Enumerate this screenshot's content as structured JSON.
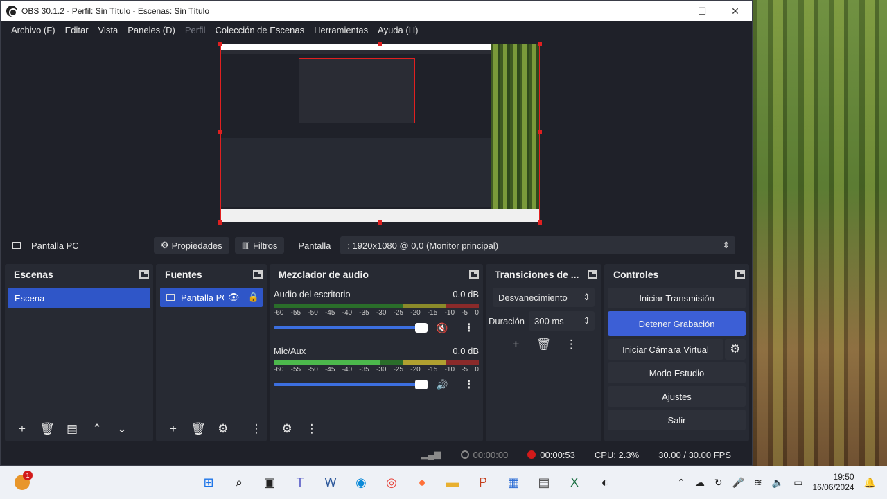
{
  "window": {
    "title": "OBS 30.1.2 - Perfil: Sin Título - Escenas: Sin Título",
    "minimize": "—",
    "maximize": "☐",
    "close": "✕"
  },
  "menu": [
    {
      "label": "Archivo (F)",
      "disabled": false
    },
    {
      "label": "Editar",
      "disabled": false
    },
    {
      "label": "Vista",
      "disabled": false
    },
    {
      "label": "Paneles (D)",
      "disabled": false
    },
    {
      "label": "Perfil",
      "disabled": true
    },
    {
      "label": "Colección de Escenas",
      "disabled": false
    },
    {
      "label": "Herramientas",
      "disabled": false
    },
    {
      "label": "Ayuda (H)",
      "disabled": false
    }
  ],
  "source_toolbar": {
    "source_name": "Pantalla PC",
    "properties": "Propiedades",
    "filters": "Filtros",
    "display_label": "Pantalla",
    "display_value": ": 1920x1080 @ 0,0 (Monitor principal)"
  },
  "docks": {
    "scenes": {
      "title": "Escenas",
      "items": [
        "Escena"
      ]
    },
    "sources": {
      "title": "Fuentes",
      "items": [
        "Pantalla PC"
      ]
    },
    "mixer": {
      "title": "Mezclador de audio",
      "channels": [
        {
          "name": "Audio del escritorio",
          "db": "0.0 dB",
          "muted": true
        },
        {
          "name": "Mic/Aux",
          "db": "0.0 dB",
          "muted": false
        }
      ],
      "scale": [
        "-60",
        "-55",
        "-50",
        "-45",
        "-40",
        "-35",
        "-30",
        "-25",
        "-20",
        "-15",
        "-10",
        "-5",
        "0"
      ]
    },
    "transitions": {
      "title": "Transiciones de ...",
      "selected": "Desvanecimiento",
      "duration_label": "Duración",
      "duration_value": "300 ms"
    },
    "controls": {
      "title": "Controles",
      "start_stream": "Iniciar Transmisión",
      "stop_recording": "Detener Grabación",
      "virtual_cam": "Iniciar Cámara Virtual",
      "studio_mode": "Modo Estudio",
      "settings": "Ajustes",
      "exit": "Salir"
    }
  },
  "status": {
    "stream_time": "00:00:00",
    "rec_time": "00:00:53",
    "cpu": "CPU: 2.3%",
    "fps": "30.00 / 30.00 FPS"
  },
  "taskbar": {
    "badge": "1",
    "time": "19:50",
    "date": "16/06/2024"
  },
  "colors": {
    "accent": "#3c5fd6",
    "rec": "#d21a1a",
    "selection": "#2f56c8"
  }
}
